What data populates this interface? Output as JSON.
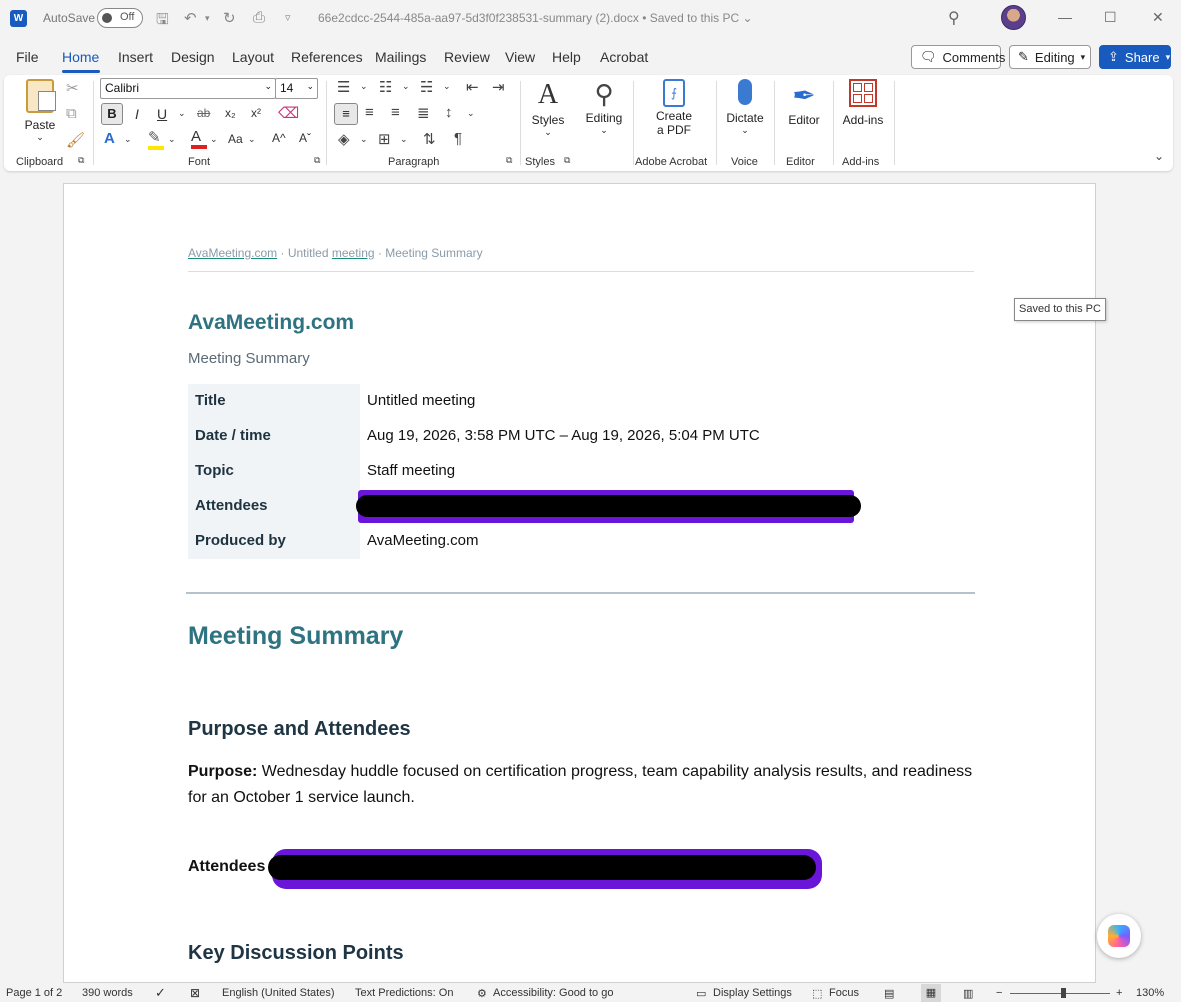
{
  "titlebar": {
    "app_logo": "W",
    "autosave_label": "AutoSave",
    "autosave_state": "Off",
    "doc_title": "66e2cdcc-2544-485a-aa97-5d3f0f238531-summary (2).docx",
    "save_status": "Saved to this PC",
    "separator": "•"
  },
  "menu": {
    "tabs": [
      "File",
      "Home",
      "Insert",
      "Design",
      "Layout",
      "References",
      "Mailings",
      "Review",
      "View",
      "Help",
      "Acrobat"
    ],
    "active_tab": "Home",
    "comments_label": "Comments",
    "editing_label": "Editing",
    "share_label": "Share"
  },
  "ribbon": {
    "font_name": "Calibri",
    "font_size": "14",
    "paste_label": "Paste",
    "styles_label": "Styles",
    "editing_label": "Editing",
    "create_pdf_line1": "Create",
    "create_pdf_line2": "a PDF",
    "dictate_label": "Dictate",
    "editor_label": "Editor",
    "addins_label": "Add-ins",
    "groups": {
      "clipboard": "Clipboard",
      "font": "Font",
      "paragraph": "Paragraph",
      "styles": "Styles",
      "adobe": "Adobe Acrobat",
      "voice": "Voice",
      "editor": "Editor",
      "addins": "Add-ins"
    }
  },
  "document": {
    "breadcrumb": {
      "part1": "AvaMeeting.com",
      "sep": "·",
      "part2a": "Untitled",
      "part2b": "meeting",
      "part3": "Meeting Summary"
    },
    "brand": "AvaMeeting.com",
    "subtitle": "Meeting Summary",
    "meta": [
      {
        "key": "Title",
        "value": "Untitled meeting"
      },
      {
        "key": "Date / time",
        "value": "Aug 19, 2026, 3:58 PM UTC – Aug 19, 2026, 5:04 PM UTC"
      },
      {
        "key": "Topic",
        "value": "Staff meeting"
      },
      {
        "key": "Attendees",
        "value": ""
      },
      {
        "key": "Produced by",
        "value": "AvaMeeting.com"
      }
    ],
    "heading1": "Meeting Summary",
    "heading_purpose": "Purpose and Attendees",
    "purpose_label": "Purpose:",
    "purpose_text": " Wednesday huddle focused on certification progress, team capability analysis results, and readiness for an October 1 service launch.",
    "attendees_label": "Attendees",
    "heading_key_points": "Key Discussion Points"
  },
  "tooltip": "Saved to this PC",
  "statusbar": {
    "page": "Page 1 of 2",
    "words": "390 words",
    "language": "English (United States)",
    "text_predictions": "Text Predictions: On",
    "accessibility": "Accessibility: Good to go",
    "display_settings": "Display Settings",
    "focus": "Focus",
    "zoom": "130%"
  },
  "colors": {
    "accent": "#185abd",
    "heading_teal": "#2e7380",
    "redaction_purple": "#6a16d8"
  }
}
